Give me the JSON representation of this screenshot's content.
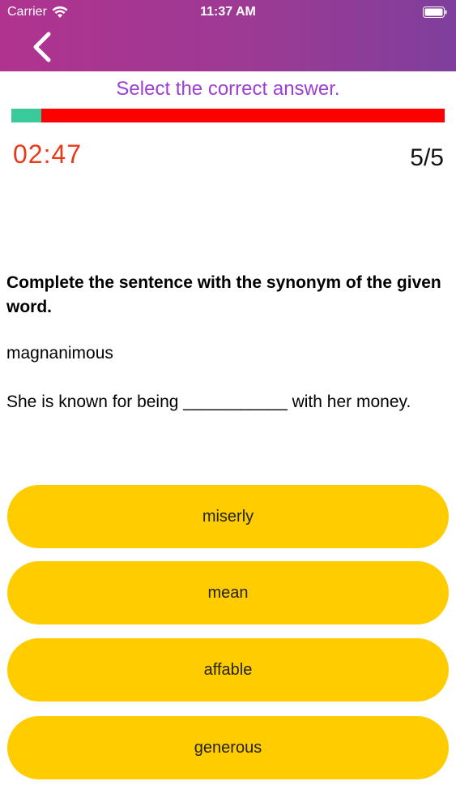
{
  "status_bar": {
    "carrier": "Carrier",
    "time": "11:37 AM",
    "wifi_icon": "wifi-icon",
    "battery_icon": "battery-icon"
  },
  "nav": {
    "back_icon": "chevron-left-icon",
    "gradient_colors": [
      "#b0338f",
      "#7f3f9c"
    ]
  },
  "quiz": {
    "instruction": "Select the correct answer.",
    "progress_fraction": 0.07,
    "progress_fill_color": "#3ac99a",
    "progress_track_color": "#ff0000",
    "timer": "02:47",
    "timer_color": "#e8391a",
    "counter": "5/5",
    "question": "Complete the sentence with the synonym of the given word.",
    "given_word": "magnanimous",
    "sentence": "She is known for being ___________ with her money.",
    "option_color": "#ffcc00",
    "options": [
      {
        "label": "miserly"
      },
      {
        "label": "mean"
      },
      {
        "label": "affable"
      },
      {
        "label": "generous"
      }
    ]
  }
}
